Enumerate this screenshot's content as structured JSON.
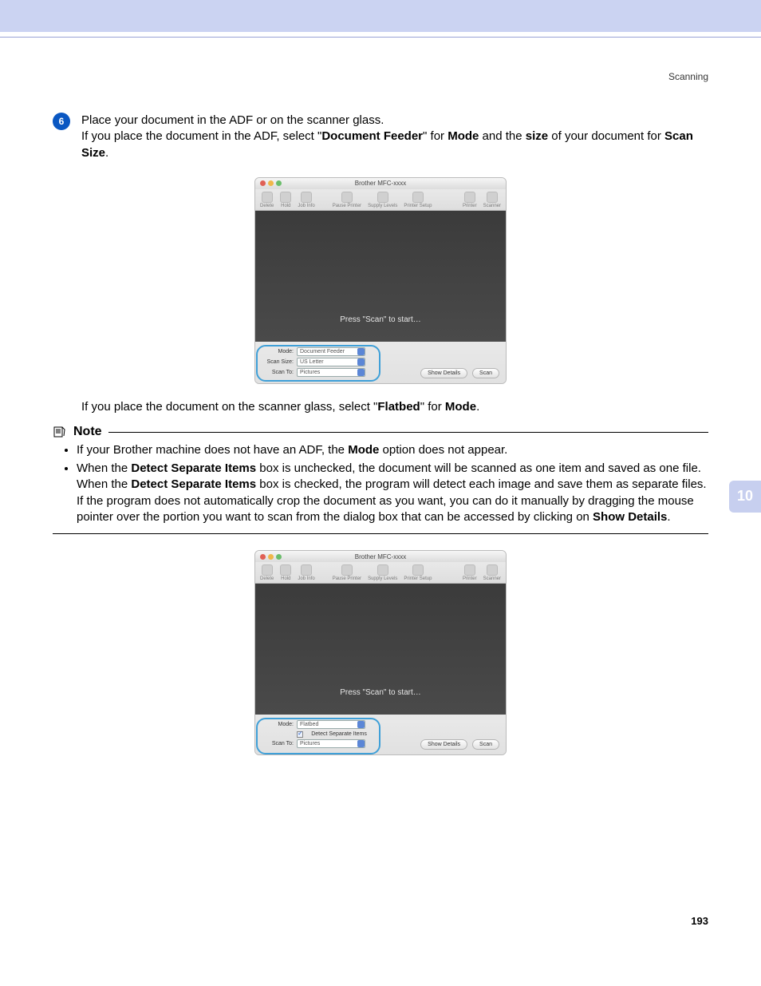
{
  "header_label": "Scanning",
  "chapter_tab": "10",
  "page_number": "193",
  "step": {
    "number": "6",
    "line1": "Place your document in the ADF or on the scanner glass.",
    "line2a": "If you place the document in the ADF, select \"",
    "line2b": "Document Feeder",
    "line2c": "\" for ",
    "line2d": "Mode",
    "line2e": " and the ",
    "line2f": "size",
    "line2g": " of your document for ",
    "line2h": "Scan Size",
    "line2i": "."
  },
  "para2a": "If you place the document on the scanner glass, select \"",
  "para2b": "Flatbed",
  "para2c": "\" for ",
  "para2d": "Mode",
  "para2e": ".",
  "note": {
    "title": "Note",
    "b1a": "If your Brother machine does not have an ADF, the ",
    "b1b": "Mode",
    "b1c": " option does not appear.",
    "b2a": "When the ",
    "b2b": "Detect Separate Items",
    "b2c": " box is unchecked, the document will be scanned as one item and saved as one file. When the ",
    "b2d": "Detect Separate Items",
    "b2e": " box is checked, the program will detect each image and save them as separate files. If the program does not automatically crop the document as you want, you can do it manually by dragging the mouse pointer over the portion you want to scan from the dialog box that can be accessed by clicking on ",
    "b2f": "Show Details",
    "b2g": "."
  },
  "fig1": {
    "title": "Brother MFC-xxxx",
    "toolbar": {
      "delete": "Delete",
      "hold": "Hold",
      "jobinfo": "Job Info",
      "pause": "Pause Printer",
      "supply": "Supply Levels",
      "setup": "Printer Setup",
      "printer": "Printer",
      "scanner": "Scanner"
    },
    "msg": "Press \"Scan\" to start…",
    "mode_label": "Mode:",
    "mode_value": "Document Feeder",
    "size_label": "Scan Size:",
    "size_value": "US Letter",
    "to_label": "Scan To:",
    "to_value": "Pictures",
    "show_details": "Show Details",
    "scan": "Scan"
  },
  "fig2": {
    "title": "Brother MFC-xxxx",
    "msg": "Press \"Scan\" to start…",
    "mode_label": "Mode:",
    "mode_value": "Flatbed",
    "checkbox_label": "Detect Separate Items",
    "to_label": "Scan To:",
    "to_value": "Pictures",
    "show_details": "Show Details",
    "scan": "Scan"
  }
}
